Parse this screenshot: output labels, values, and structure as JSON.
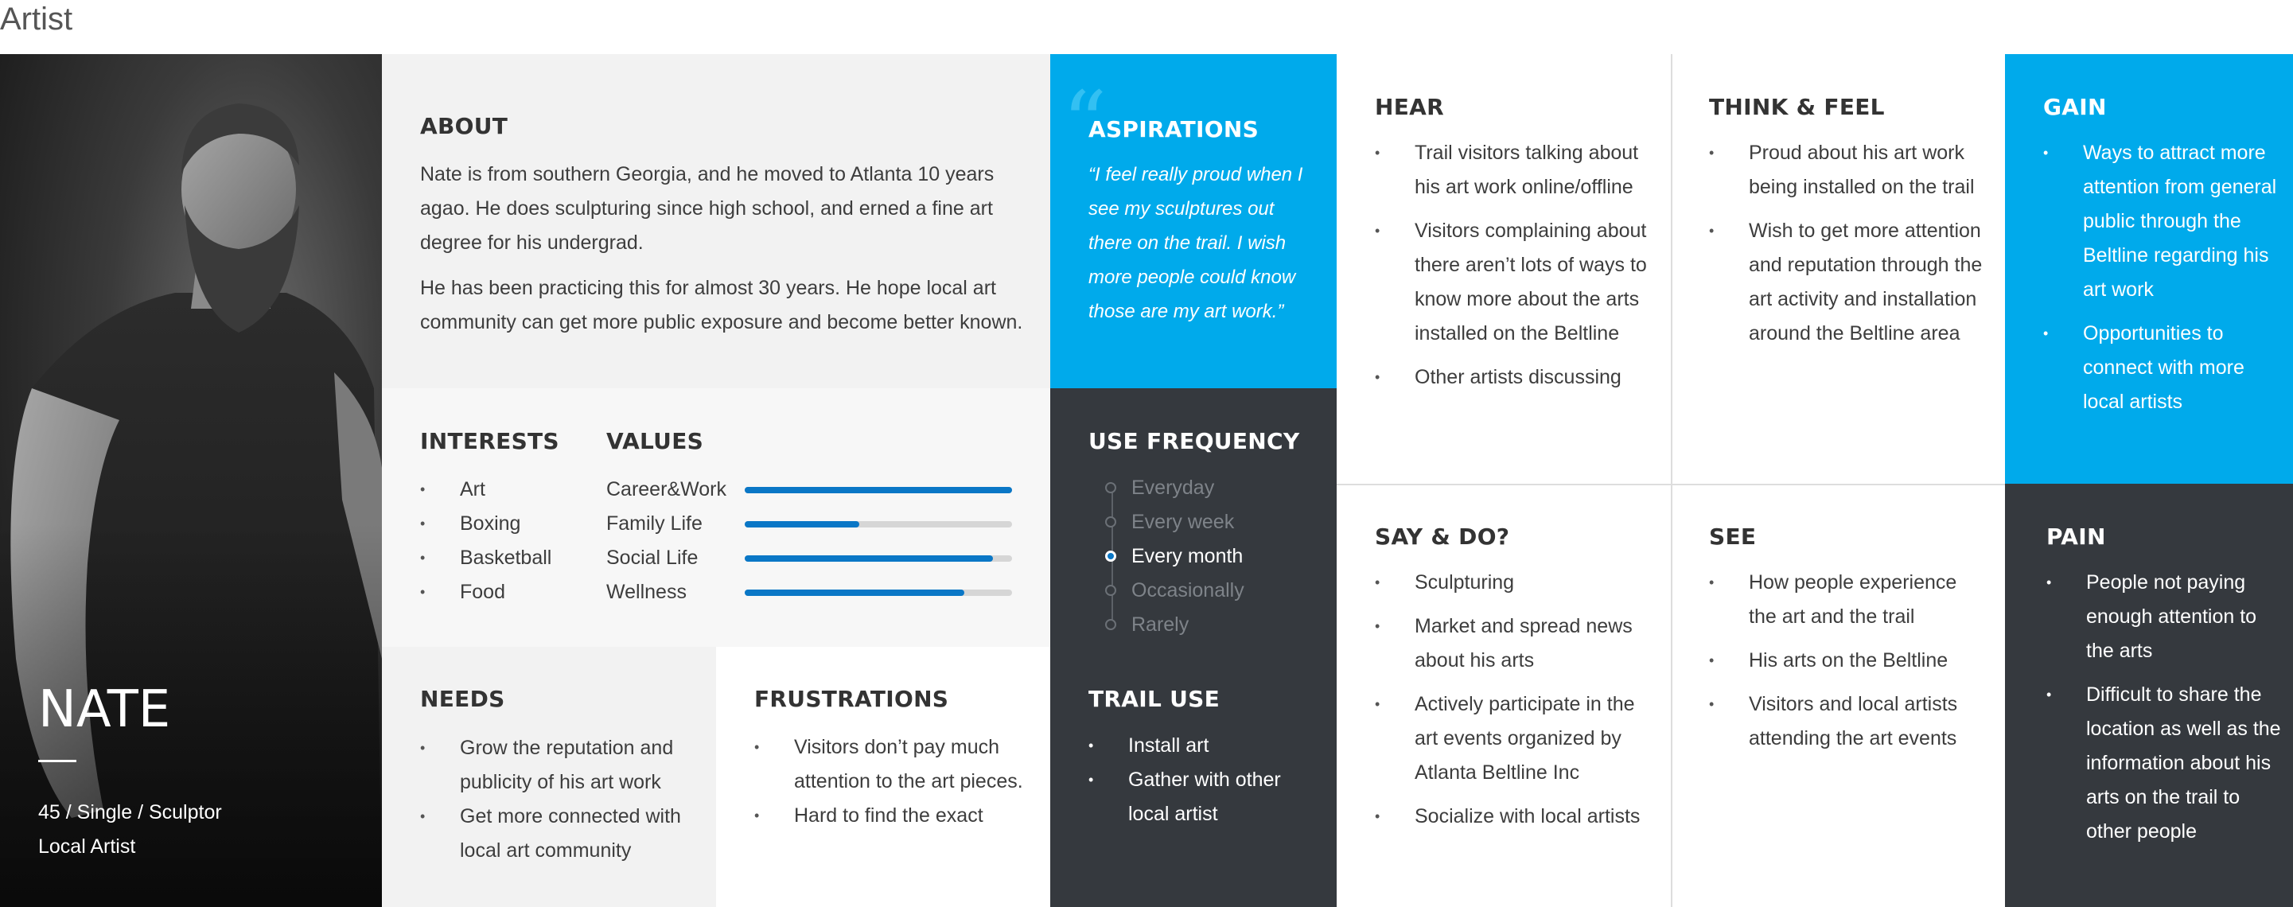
{
  "page_title": "Artist",
  "persona": {
    "name": "NATE",
    "meta_line1": "45 / Single / Sculptor",
    "meta_line2": "Local Artist"
  },
  "about": {
    "heading": "ABOUT",
    "paragraphs": [
      "Nate is from southern Georgia, and he moved to Atlanta 10 years agao. He does sculpturing since high school, and erned a fine art degree for his undergrad.",
      "He has been practicing this for almost 30 years. He hope local art community can get more public exposure and become better known."
    ]
  },
  "interests": {
    "heading": "INTERESTS",
    "items": [
      "Art",
      "Boxing",
      "Basketball",
      "Food"
    ]
  },
  "values": {
    "heading": "VALUES",
    "items": [
      {
        "label": "Career&Work",
        "level": 1.0
      },
      {
        "label": "Family Life",
        "level": 0.43
      },
      {
        "label": "Social Life",
        "level": 0.93
      },
      {
        "label": "Wellness",
        "level": 0.82
      }
    ]
  },
  "needs": {
    "heading": "NEEDS",
    "items": [
      "Grow the reputation and publicity of his art work",
      "Get more connected with local art community"
    ]
  },
  "frustrations": {
    "heading": "FRUSTRATIONS",
    "items": [
      "Visitors don’t pay much attention to the art pieces.",
      "Hard to find the exact"
    ]
  },
  "aspirations": {
    "heading": "ASPIRATIONS",
    "quote": "“I feel really proud when I see my sculptures out there on the trail. I wish more people could know those are my art work.”"
  },
  "use_frequency": {
    "heading": "USE FREQUENCY",
    "options": [
      "Everyday",
      "Every week",
      "Every month",
      "Occasionally",
      "Rarely"
    ],
    "selected": "Every month"
  },
  "trail_use": {
    "heading": "TRAIL USE",
    "items": [
      "Install art",
      "Gather with other local artist"
    ]
  },
  "hear": {
    "heading": "HEAR",
    "items": [
      "Trail visitors talking about his art work online/offline",
      "Visitors complaining about there aren’t lots of ways to know more about the arts installed on the Beltline",
      "Other artists discussing"
    ]
  },
  "think_feel": {
    "heading": "THINK & FEEL",
    "items": [
      "Proud about his art work being installed on the trail",
      "Wish to get more attention and reputation through the art activity and installation around the Beltline area"
    ]
  },
  "gain": {
    "heading": "GAIN",
    "items": [
      "Ways to attract more attention from general public through the Beltline regarding his art work",
      "Opportunities to connect with more local artists"
    ]
  },
  "say_do": {
    "heading": "SAY & DO?",
    "items": [
      "Sculpturing",
      "Market and spread news about his arts",
      "Actively participate in the art events organized by Atlanta Beltline Inc",
      "Socialize with local artists"
    ]
  },
  "see": {
    "heading": "SEE",
    "items": [
      "How people experience the art and the trail",
      "His arts on the Beltline",
      "Visitors and local artists attending the art events"
    ]
  },
  "pain": {
    "heading": "PAIN",
    "items": [
      "People not paying enough attention to the arts",
      "Difficult to share the location as well as the information about his arts on the trail to other people"
    ]
  },
  "colors": {
    "accent_blue": "#00aaeb",
    "dark_panel": "#35393e",
    "bar_blue": "#0a77c6"
  }
}
